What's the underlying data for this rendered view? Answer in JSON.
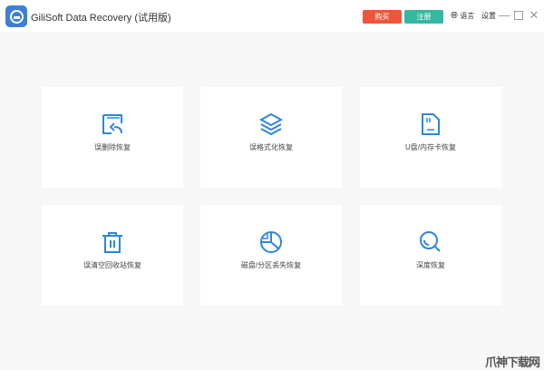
{
  "app": {
    "title": "GiliSoft Data Recovery (试用版)"
  },
  "header": {
    "buy_label": "购买",
    "register_label": "注册",
    "language_label": "语言",
    "settings_label": "设置"
  },
  "colors": {
    "accent": "#2f86d6",
    "buy": "#f0553a",
    "register": "#35b8a0"
  },
  "cards": [
    {
      "label": "误删除恢复",
      "icon": "file-restore-icon"
    },
    {
      "label": "误格式化恢复",
      "icon": "layers-icon"
    },
    {
      "label": "U盘/内存卡恢复",
      "icon": "sd-card-icon"
    },
    {
      "label": "误清空回收站恢复",
      "icon": "trash-icon"
    },
    {
      "label": "磁盘/分区丢失恢复",
      "icon": "pie-chart-icon"
    },
    {
      "label": "深度恢复",
      "icon": "search-icon"
    }
  ],
  "watermark": "爪神下载网"
}
